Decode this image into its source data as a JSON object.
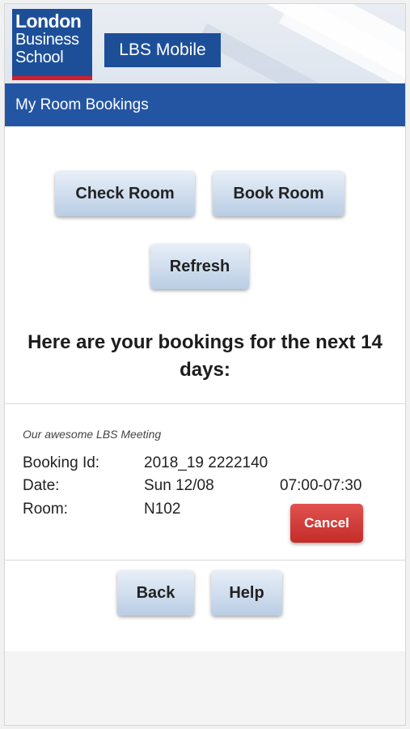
{
  "logo": {
    "line1": "London",
    "line2": "Business",
    "line3": "School"
  },
  "header": {
    "app_name": "LBS Mobile"
  },
  "title_bar": {
    "title": "My Room Bookings"
  },
  "actions": {
    "check_room": "Check Room",
    "book_room": "Book Room",
    "refresh": "Refresh"
  },
  "bookings_heading": "Here are your bookings for the next 14 days:",
  "booking": {
    "title": "Our awesome LBS Meeting",
    "id_label": "Booking Id:",
    "id_value": "2018_19 2222140",
    "date_label": "Date:",
    "date_value": "Sun 12/08",
    "time_value": "07:00-07:30",
    "room_label": "Room:",
    "room_value": "N102",
    "cancel_label": "Cancel"
  },
  "footer": {
    "back": "Back",
    "help": "Help"
  },
  "colors": {
    "brand_blue": "#1d4f99",
    "title_bar_blue": "#2455a3",
    "logo_red": "#d11f2f",
    "cancel_red": "#c42c28",
    "button_light_blue": "#b9cde4"
  }
}
